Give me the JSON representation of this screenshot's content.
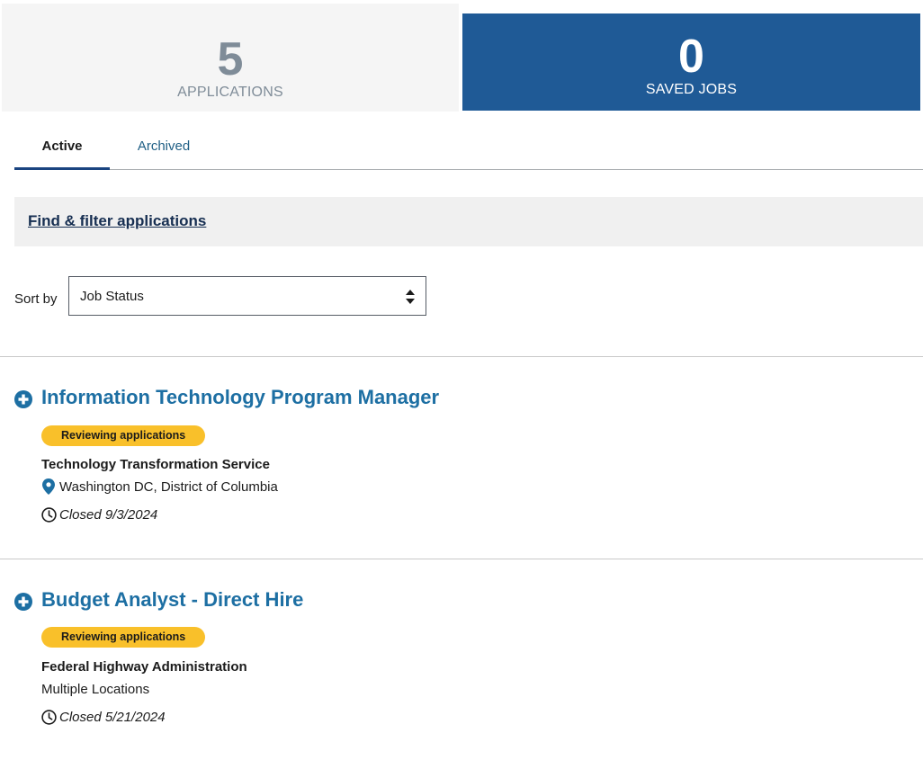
{
  "summary": {
    "applications": {
      "count": "5",
      "label": "APPLICATIONS"
    },
    "saved_jobs": {
      "count": "0",
      "label": "SAVED JOBS"
    }
  },
  "tabs": [
    {
      "label": "Active",
      "active": true
    },
    {
      "label": "Archived",
      "active": false
    }
  ],
  "filter": {
    "link_label": "Find & filter applications"
  },
  "sort": {
    "label": "Sort by",
    "selected": "Job Status"
  },
  "applications": [
    {
      "title": "Information Technology Program Manager",
      "status": "Reviewing applications",
      "agency": "Technology Transformation Service",
      "location": "Washington DC, District of Columbia",
      "location_icon": "map-pin-icon",
      "closed": "Closed 9/3/2024"
    },
    {
      "title": "Budget Analyst - Direct Hire",
      "status": "Reviewing applications",
      "agency": "Federal Highway Administration",
      "location": "Multiple Locations",
      "location_icon": "",
      "closed": "Closed 5/21/2024"
    }
  ],
  "colors": {
    "saved_jobs_tile": "#1f5a96",
    "title_link": "#1d6fa3",
    "status_badge": "#f9c02a",
    "tab_underline": "#1a4480"
  }
}
